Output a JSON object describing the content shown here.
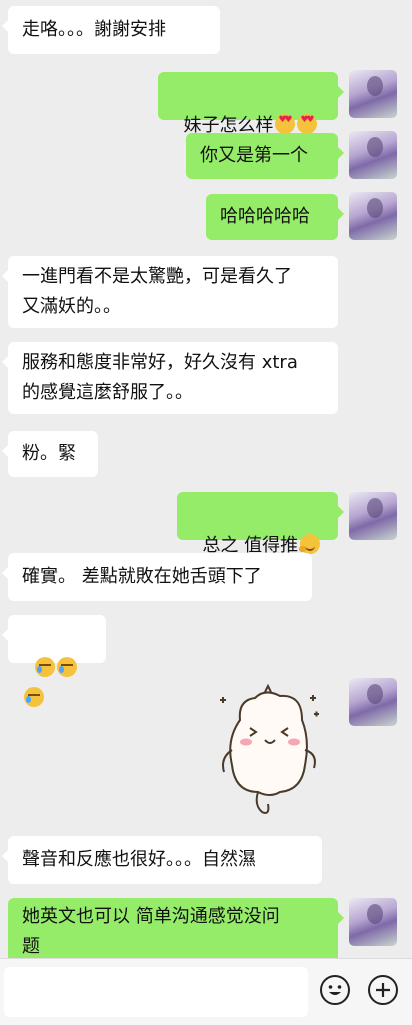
{
  "messages": [
    {
      "dir": "in",
      "text": "走咯。。。謝謝安排"
    },
    {
      "dir": "out",
      "text": "妹子怎么样"
    },
    {
      "dir": "out",
      "text": "你又是第一个"
    },
    {
      "dir": "out",
      "text": "哈哈哈哈哈"
    },
    {
      "dir": "in",
      "text": "一進門看不是太驚艷，可是看久了\n又滿妖的。。"
    },
    {
      "dir": "in",
      "text": "服務和態度非常好，好久沒有 xtra\n的感覺這麼舒服了。。"
    },
    {
      "dir": "in",
      "text": "粉。緊"
    },
    {
      "dir": "out",
      "text": "总之 值得推"
    },
    {
      "dir": "in",
      "text": "確實。 差點就敗在她舌頭下了"
    },
    {
      "dir": "in",
      "text": ""
    },
    {
      "dir": "in",
      "text": "聲音和反應也很好。。。自然濕"
    },
    {
      "dir": "out",
      "text": "她英文也可以 简单沟通感觉没问\n题"
    }
  ],
  "emojis": {
    "heart_eyes": "heart-eyes-emoji",
    "crying": "crying-emoji",
    "hugging": "hugging-emoji"
  },
  "composer": {
    "input_value": "",
    "emoji_icon": "smiley-icon",
    "more_icon": "plus-icon"
  },
  "colors": {
    "background": "#ededed",
    "outgoing_bubble": "#95ec69",
    "incoming_bubble": "#ffffff"
  }
}
